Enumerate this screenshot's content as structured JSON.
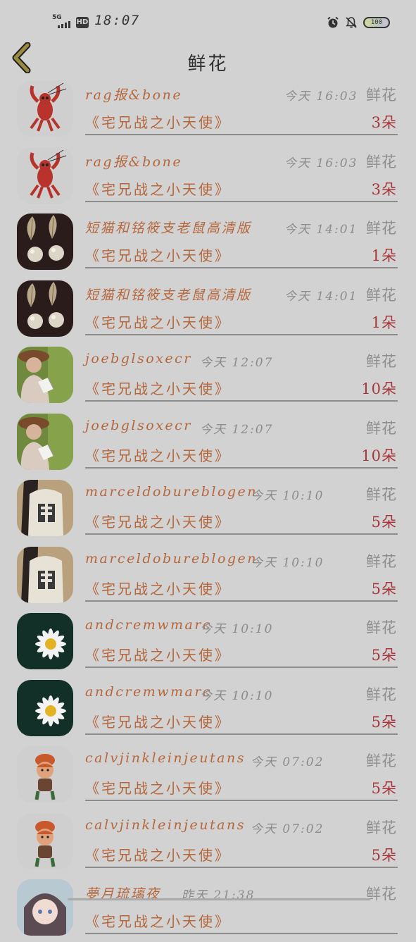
{
  "status_bar": {
    "network": "5G",
    "hd": "HD",
    "time": "18:07",
    "battery": "100",
    "icons": [
      "signal-icon",
      "alarm-icon",
      "bell-off-icon",
      "battery-icon"
    ]
  },
  "header": {
    "title": "鲜花",
    "back_icon": "chevron-left-icon"
  },
  "colors": {
    "background": "#d2d2d2",
    "name": "#b5673c",
    "time": "#8c8c8c",
    "quantity": "#a8373c",
    "back_icon": "#8a7a3a"
  },
  "records": [
    {
      "name": "rag报&bone",
      "time": "今天 16:03",
      "type": "鲜花",
      "book": "《宅兄战之小天使》",
      "qty": "3朵",
      "avatar": "lobster"
    },
    {
      "name": "rag报&bone",
      "time": "今天 16:03",
      "type": "鲜花",
      "book": "《宅兄战之小天使》",
      "qty": "3朵",
      "avatar": "lobster"
    },
    {
      "name": "短猫和铭筱支老鼠高清版",
      "time": "今天 14:01",
      "type": "鲜花",
      "book": "《宅兄战之小天使》",
      "qty": "1朵",
      "avatar": "earrings"
    },
    {
      "name": "短猫和铭筱支老鼠高清版",
      "time": "今天 14:01",
      "type": "鲜花",
      "book": "《宅兄战之小天使》",
      "qty": "1朵",
      "avatar": "earrings"
    },
    {
      "name": "joebglsoxecr",
      "time": "今天 12:07",
      "type": "鲜花",
      "book": "《宅兄战之小天使》",
      "qty": "10朵",
      "avatar": "reader"
    },
    {
      "name": "joebglsoxecr",
      "time": "今天 12:07",
      "type": "鲜花",
      "book": "《宅兄战之小天使》",
      "qty": "10朵",
      "avatar": "reader"
    },
    {
      "name": "marceldobureblogen",
      "time": "今天 10:10",
      "type": "鲜花",
      "book": "《宅兄战之小天使》",
      "qty": "5朵",
      "avatar": "shirt"
    },
    {
      "name": "marceldobureblogen",
      "time": "今天 10:10",
      "type": "鲜花",
      "book": "《宅兄战之小天使》",
      "qty": "5朵",
      "avatar": "shirt"
    },
    {
      "name": "andcremwmarc",
      "time": "今天 10:10",
      "type": "鲜花",
      "book": "《宅兄战之小天使》",
      "qty": "5朵",
      "avatar": "flower"
    },
    {
      "name": "andcremwmarc",
      "time": "今天 10:10",
      "type": "鲜花",
      "book": "《宅兄战之小天使》",
      "qty": "5朵",
      "avatar": "flower"
    },
    {
      "name": "calvjinkleinjeutans",
      "time": "今天 07:02",
      "type": "鲜花",
      "book": "《宅兄战之小天使》",
      "qty": "5朵",
      "avatar": "cartoon"
    },
    {
      "name": "calvjinkleinjeutans",
      "time": "今天 07:02",
      "type": "鲜花",
      "book": "《宅兄战之小天使》",
      "qty": "5朵",
      "avatar": "cartoon"
    },
    {
      "name": "夢月琉璃夜",
      "time": "昨天 21:38",
      "type": "鲜花",
      "book": "《宅兄战之小天使》",
      "qty": "",
      "avatar": "anime"
    }
  ]
}
